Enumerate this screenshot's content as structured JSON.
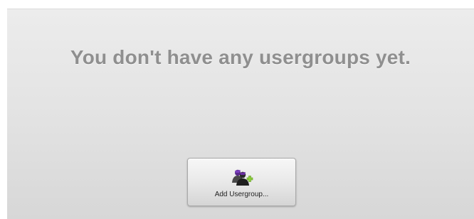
{
  "empty_state": {
    "message": "You don't have any usergroups yet."
  },
  "add_button": {
    "label": "Add Usergroup...",
    "icon": "usergroup-add-icon"
  },
  "colors": {
    "message_text": "#8f8f8f",
    "panel_top": "#ececec",
    "panel_bottom": "#d7d7d7",
    "icon_purple": "#6b2fa3",
    "icon_plus": "#8fd13c"
  }
}
